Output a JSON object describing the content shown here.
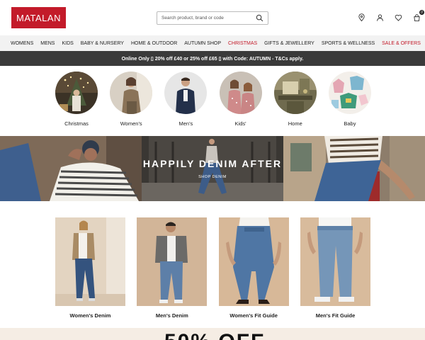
{
  "header": {
    "logo": "MATALAN",
    "search_placeholder": "Search product, brand or code",
    "basket_count": "0"
  },
  "nav": {
    "items": [
      "WOMENS",
      "MENS",
      "KIDS",
      "BABY & NURSERY",
      "HOME & OUTDOOR",
      "AUTUMN SHOP",
      "CHRISTMAS",
      "GIFTS & JEWELLERY",
      "SPORTS & WELLNESS",
      "SALE & OFFERS"
    ]
  },
  "promo": {
    "text": "Online Only ▯ 20% off £40 or 25% off £65 ▯ with Code: AUTUMN - T&Cs apply."
  },
  "categories": [
    "Christmas",
    "Women's",
    "Men's",
    "Kids'",
    "Home",
    "Baby"
  ],
  "hero": {
    "title": "HAPPILY DENIM AFTER",
    "subtitle": "SHOP DENIM"
  },
  "tiles": [
    "Women's Denim",
    "Men's Denim",
    "Women's Fit Guide",
    "Men's Fit Guide"
  ],
  "bottom": {
    "headline": "50% OFF"
  },
  "colors": {
    "brand": "#c31b2a",
    "promo_bg": "#3a3a3a",
    "nav_bg": "#f2f2f2"
  }
}
